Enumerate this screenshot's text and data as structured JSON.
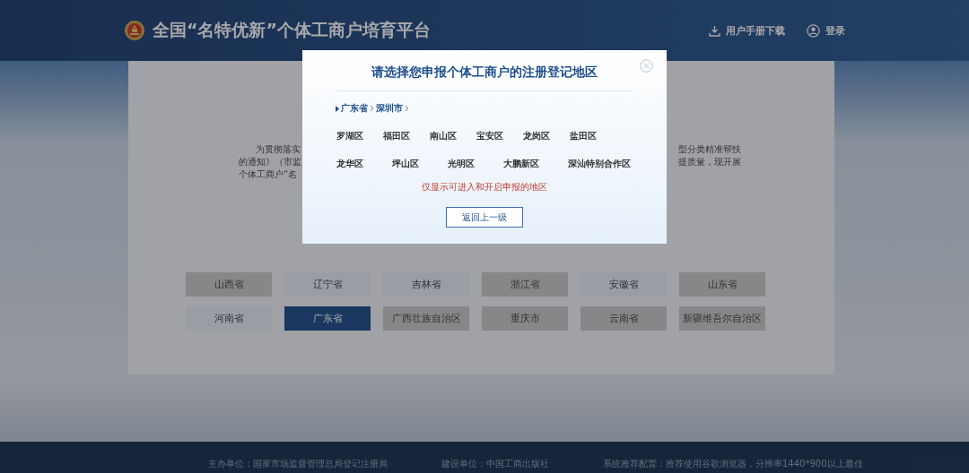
{
  "header": {
    "title": "全国“名特优新”个体工商户培育平台",
    "links": [
      {
        "kind": "download",
        "label": "用户手册下载"
      },
      {
        "kind": "user",
        "label": "登录"
      }
    ]
  },
  "intro_left": [
    "为贯彻落实",
    "的通知》（市监",
    "个体工商户“名"
  ],
  "intro_right": [
    "型分类精准帮扶",
    "提质量，现开展"
  ],
  "provinces": [
    {
      "label": "山西省",
      "available": false,
      "selected": false
    },
    {
      "label": "辽宁省",
      "available": true,
      "selected": false
    },
    {
      "label": "吉林省",
      "available": true,
      "selected": false
    },
    {
      "label": "浙江省",
      "available": false,
      "selected": false
    },
    {
      "label": "安徽省",
      "available": true,
      "selected": false
    },
    {
      "label": "山东省",
      "available": false,
      "selected": false
    },
    {
      "label": "河南省",
      "available": true,
      "selected": false
    },
    {
      "label": "广东省",
      "available": true,
      "selected": true
    },
    {
      "label": "广西壮族自治区",
      "available": false,
      "selected": false
    },
    {
      "label": "重庆市",
      "available": false,
      "selected": false
    },
    {
      "label": "云南省",
      "available": false,
      "selected": false
    },
    {
      "label": "新疆维吾尔自治区",
      "available": false,
      "selected": false
    }
  ],
  "footer": [
    "主办单位：国家市场监督管理总局登记注册局",
    "建设单位：中国工商出版社",
    "系统推荐配置：推荐使用谷歌浏览器，分辨率1440*900以上最佳"
  ],
  "modal": {
    "title": "请选择您申报个体工商户的注册登记地区",
    "breadcrumb": [
      "广东省",
      "深圳市"
    ],
    "district_rows": [
      [
        "罗湖区",
        "福田区",
        "南山区",
        "宝安区",
        "龙岗区",
        "盐田区"
      ],
      [
        "龙华区",
        "坪山区",
        "光明区",
        "大鹏新区",
        "深汕特别合作区"
      ]
    ],
    "note": "仅显示可进入和开启申报的地区",
    "back_button": "返回上一级"
  }
}
